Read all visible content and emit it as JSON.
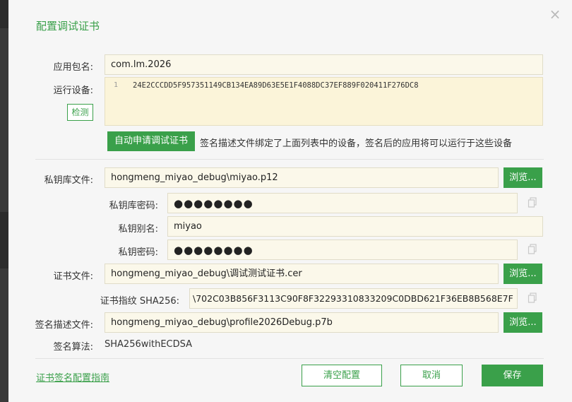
{
  "dialog": {
    "title": "配置调试证书",
    "close_icon": "×"
  },
  "form": {
    "package_label": "应用包名:",
    "package_value": "com.lm.2026",
    "device_label": "运行设备:",
    "detect_label": "检测",
    "device_line_number": "1",
    "device_id": "24E2CCCDD5F957351149CB134EA89D63E5E1F4088DC37EF889F020411F276DC8",
    "auto_apply_label": "自动申请调试证书",
    "auto_apply_hint": "签名描述文件绑定了上面列表中的设备，签名后的应用将可以运行于这些设备",
    "keystore_label": "私钥库文件:",
    "keystore_value": "hongmeng_miyao_debug\\miyao.p12",
    "keystore_password_label": "私钥库密码:",
    "keystore_password_value": "●●●●●●●●",
    "key_alias_label": "私钥别名:",
    "key_alias_value": "miyao",
    "key_password_label": "私钥密码:",
    "key_password_value": "●●●●●●●●",
    "cert_label": "证书文件:",
    "cert_value": "hongmeng_miyao_debug\\调试测试证书.cer",
    "fingerprint_label": "证书指纹 SHA256:",
    "fingerprint_value": "\\702C03B856F3113C90F8F32293310833209C0DBD621F36EB8B568E7F",
    "profile_label": "签名描述文件:",
    "profile_value": "hongmeng_miyao_debug\\profile2026Debug.p7b",
    "algorithm_label": "签名算法:",
    "algorithm_value": "SHA256withECDSA",
    "browse_label": "浏览..."
  },
  "footer": {
    "guide_link": "证书签名配置指南",
    "clear_label": "清空配置",
    "cancel_label": "取消",
    "save_label": "保存"
  },
  "colors": {
    "accent": "#3aa04a",
    "field_bg": "#fbf8ea",
    "code_bg": "#fbf4d9"
  },
  "icons": {
    "copy": "copy-icon",
    "close": "close-icon"
  }
}
